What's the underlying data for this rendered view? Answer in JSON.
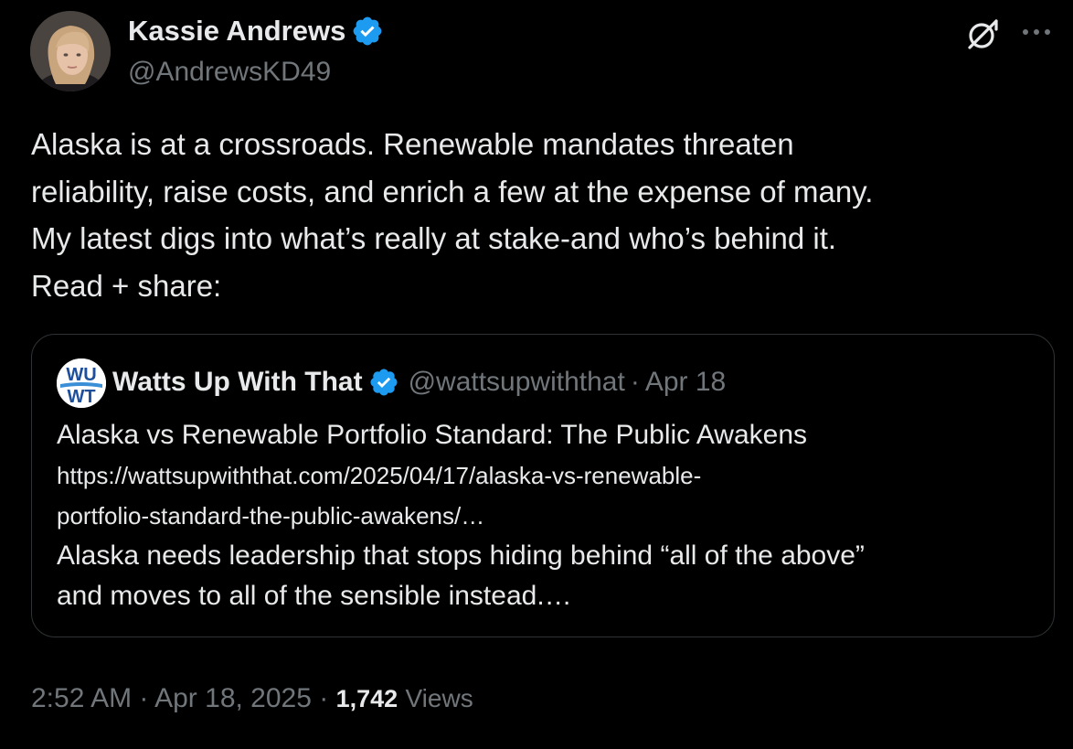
{
  "author": {
    "name": "Kassie Andrews",
    "handle": "@AndrewsKD49",
    "avatar_icon": "profile-photo"
  },
  "tweet": {
    "lines": [
      "Alaska is at a crossroads.  Renewable mandates threaten",
      "reliability, raise costs, and enrich a few at the expense of many.",
      "My latest digs into what’s really at stake-and who’s behind it.",
      "Read + share:"
    ]
  },
  "quote": {
    "avatar_text_top": "WU",
    "avatar_text_bottom": "WT",
    "name": "Watts Up With That",
    "handle": "@wattsupwiththat",
    "separator": "·",
    "date": "Apr 18",
    "title": "Alaska vs Renewable Portfolio Standard: The Public Awakens",
    "link_line1": "https://wattsupwiththat.com/2025/04/17/alaska-vs-renewable-",
    "link_line2": "portfolio-standard-the-public-awakens/…",
    "excerpt_line1": "Alaska needs leadership that stops hiding behind “all of the above”",
    "excerpt_line2": "and moves to all of the sensible instead.…"
  },
  "meta": {
    "time": "2:52 AM",
    "separator": "·",
    "date": "Apr 18, 2025",
    "views_count": "1,742",
    "views_label": "Views"
  },
  "colors": {
    "background": "#000000",
    "text_primary": "#e7e9ea",
    "text_secondary": "#71767b",
    "verified_blue": "#1d9bf0",
    "border": "#2f3336"
  },
  "icons": {
    "verified": "verified-badge-icon",
    "grok": "grok-icon",
    "more": "more-options-icon"
  }
}
